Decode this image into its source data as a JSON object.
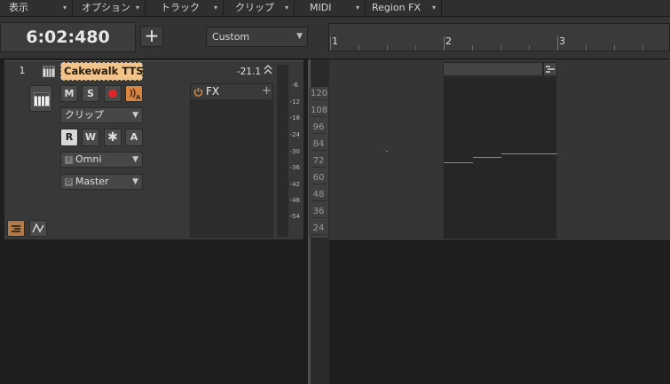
{
  "menubar": {
    "items": [
      {
        "label": "表示"
      },
      {
        "label": "オプション"
      },
      {
        "label": "トラック"
      },
      {
        "label": "クリップ"
      },
      {
        "label": "MIDI"
      },
      {
        "label": "Region FX"
      }
    ]
  },
  "transport": {
    "time": "6:02:480",
    "add_label": "+",
    "preset": "Custom"
  },
  "ruler": {
    "marks": [
      "1",
      "2",
      "3"
    ]
  },
  "track": {
    "number": "1",
    "name": "Cakewalk TTS-",
    "volume": "-21.1",
    "buttons": {
      "mute": "M",
      "solo": "S",
      "read": "R",
      "write": "W",
      "freeze": "✱",
      "auto": "A"
    },
    "clip_mode": "クリップ",
    "input": "Omni",
    "output": "Master",
    "input_tag": "I",
    "output_tag": "O",
    "fx_label": "FX",
    "fx_add": "+"
  },
  "meter_labels": [
    "-6",
    "-12",
    "-18",
    "-24",
    "-30",
    "-36",
    "-42",
    "-48",
    "-54"
  ],
  "scale_labels": [
    "120",
    "108",
    "96",
    "84",
    "72",
    "60",
    "48",
    "36",
    "24"
  ],
  "colors": {
    "accent": "#d0753c",
    "name_bg": "#f2c38b"
  },
  "icons": {
    "caret": "▾",
    "piano": "piano-icon",
    "record": "record-icon",
    "echo": "input-echo-icon",
    "power": "power-icon",
    "collapse": "collapse-up-icon",
    "tracks_view": "track-view-icon",
    "automation": "automation-lane-icon",
    "clip_menu": "clip-menu-icon"
  }
}
